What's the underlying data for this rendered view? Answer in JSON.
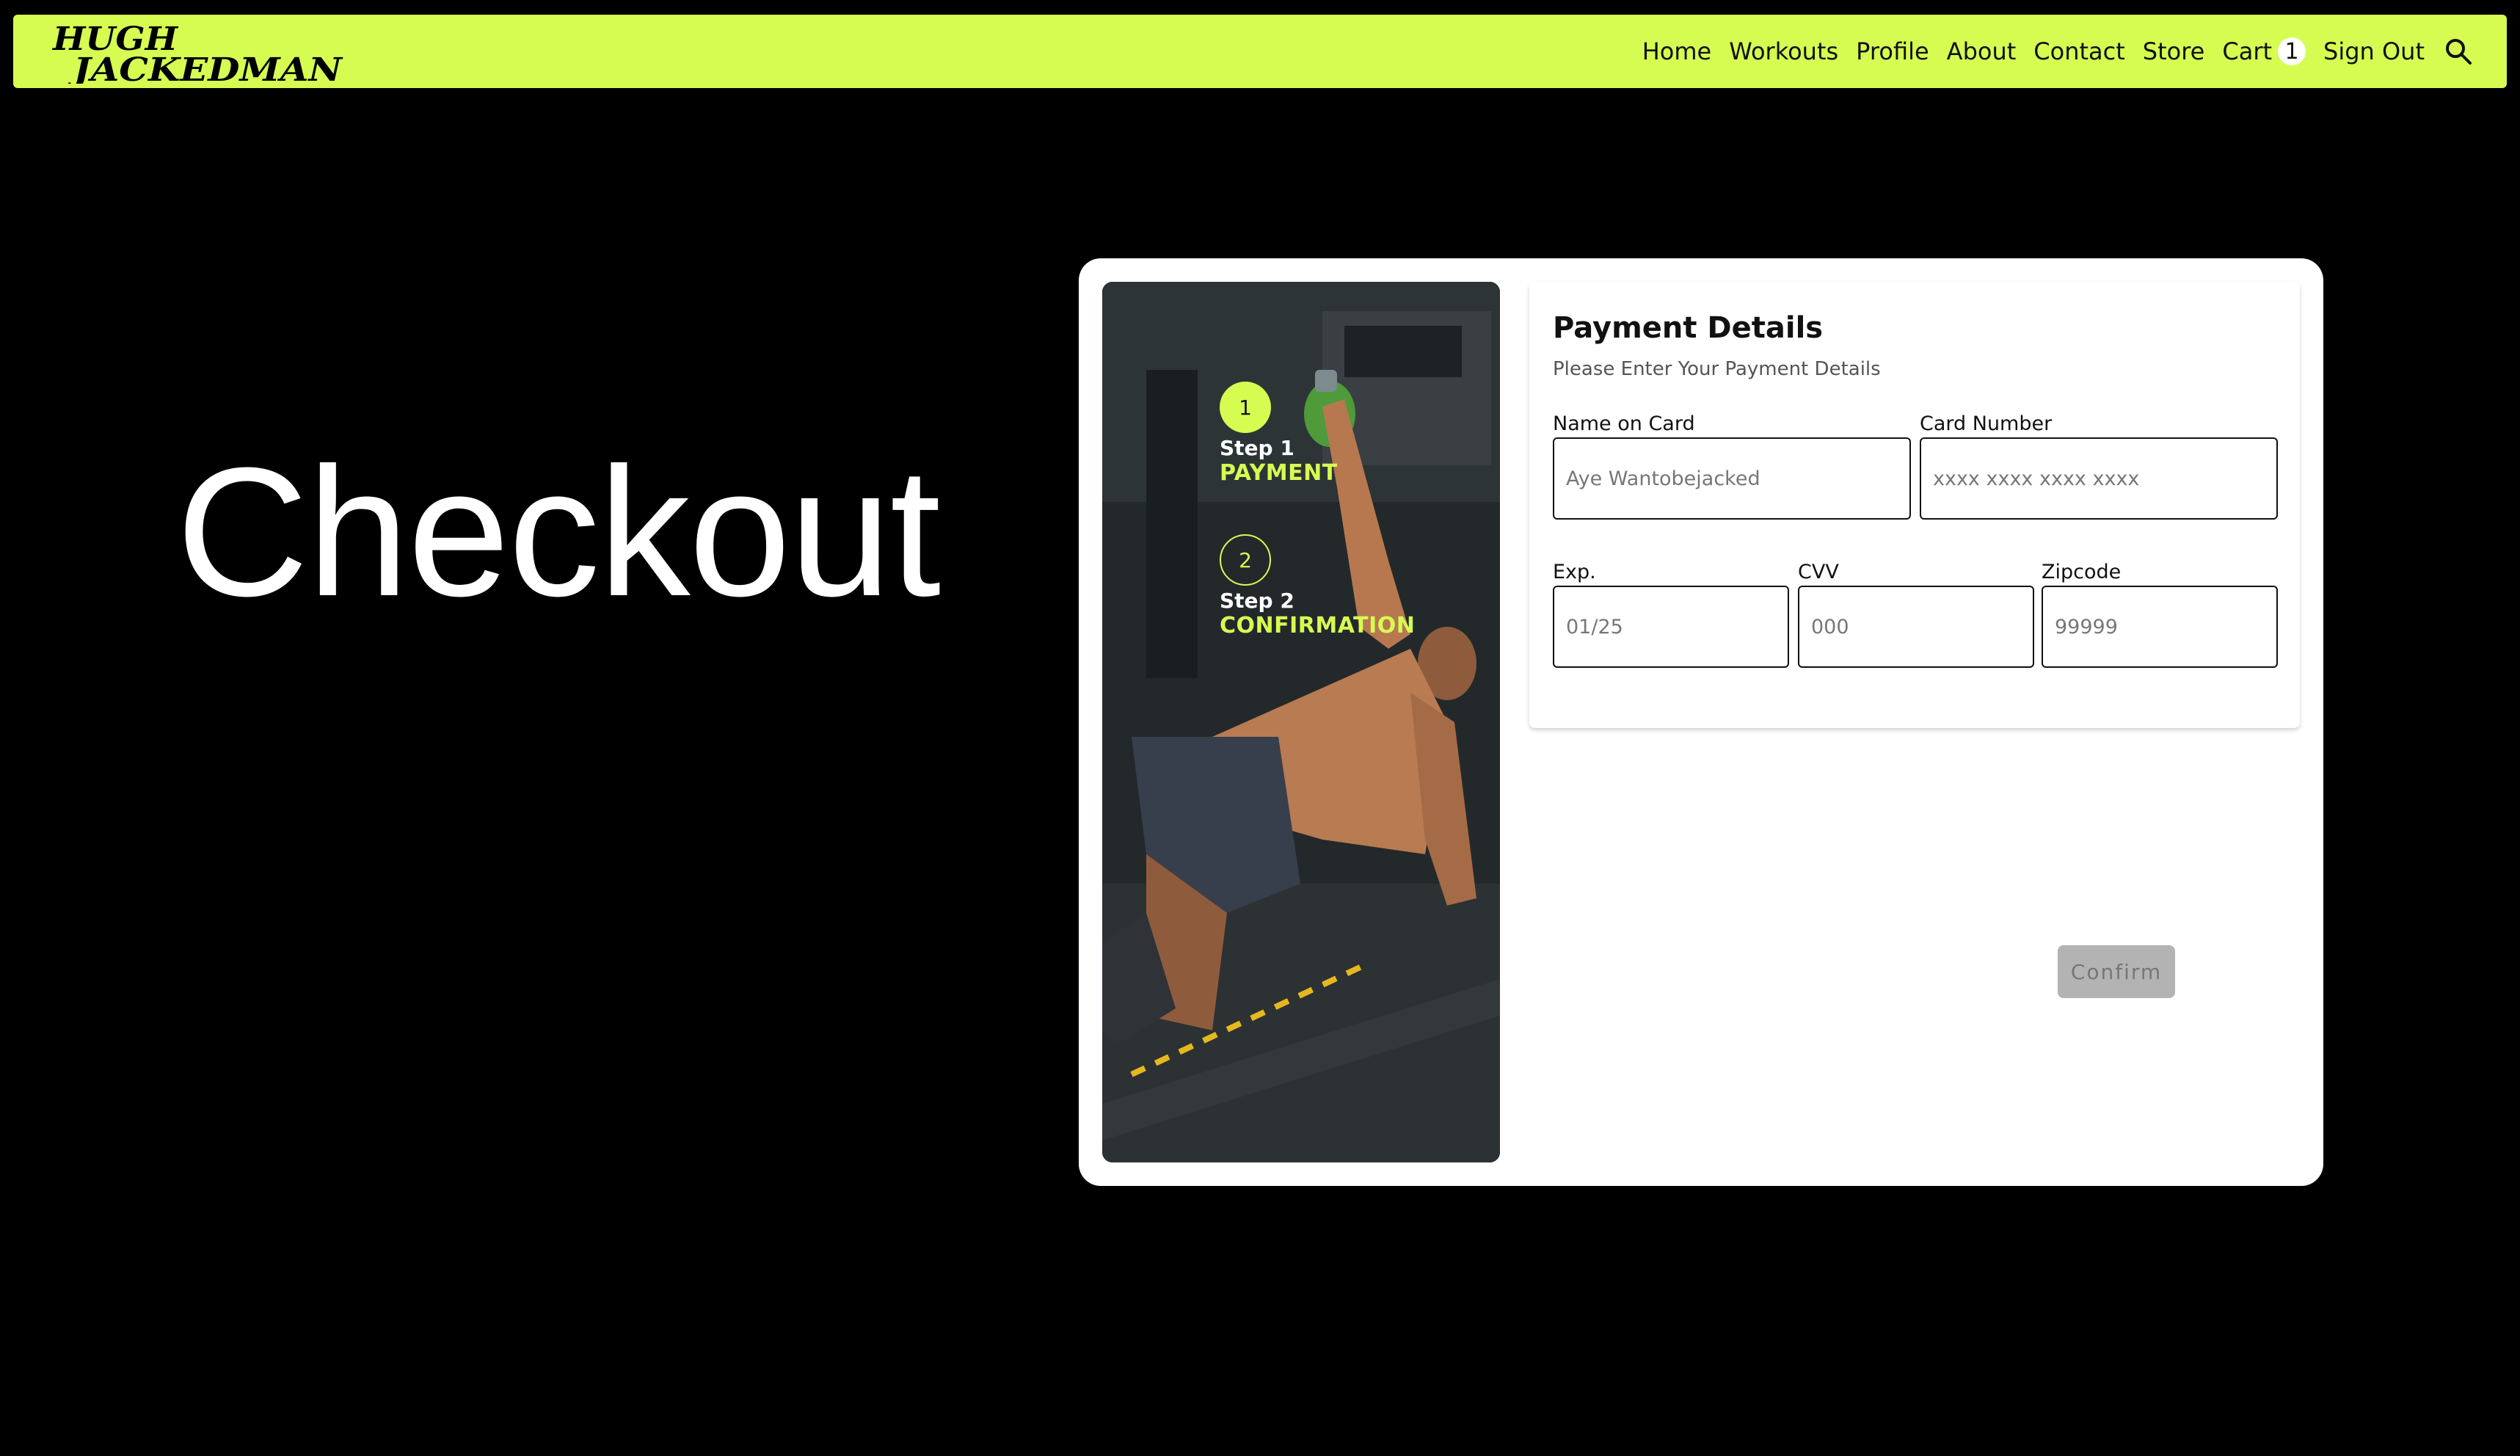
{
  "nav": {
    "logo_text": "HUGH JACKEDMAN",
    "links": [
      "Home",
      "Workouts",
      "Profile",
      "About",
      "Contact",
      "Store"
    ],
    "cart_label": "Cart",
    "cart_count": "1",
    "sign_out_label": "Sign Out",
    "search_icon": "search-icon"
  },
  "page": {
    "title": "Checkout"
  },
  "steps": [
    {
      "number": "1",
      "label": "Step 1",
      "title": "PAYMENT",
      "active": true
    },
    {
      "number": "2",
      "label": "Step 2",
      "title": "CONFIRMATION",
      "active": false
    }
  ],
  "payment": {
    "title": "Payment Details",
    "subtitle": "Please Enter Your Payment Details",
    "name_label": "Name on Card",
    "name_placeholder": "Aye Wantobejacked",
    "card_label": "Card Number",
    "card_placeholder": "xxxx xxxx xxxx xxxx",
    "exp_label": "Exp.",
    "exp_placeholder": "01/25",
    "cvv_label": "CVV",
    "cvv_placeholder": "000",
    "zip_label": "Zipcode",
    "zip_placeholder": "99999",
    "confirm_label": "Confirm"
  },
  "colors": {
    "accent": "#d6fc52",
    "background": "#000000",
    "card": "#ffffff",
    "button_disabled": "#b3b3b3"
  }
}
